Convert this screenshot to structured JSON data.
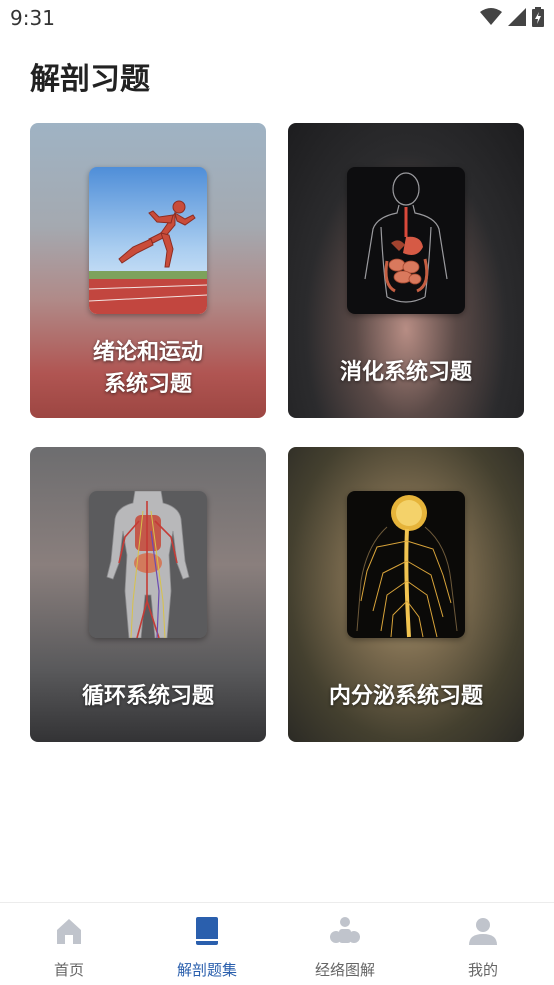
{
  "status_bar": {
    "time": "9:31"
  },
  "page": {
    "title": "解剖习题"
  },
  "cards": [
    {
      "label_line1": "绪论和运动",
      "label_line2": "系统习题",
      "image": "running-muscle-figure"
    },
    {
      "label": "消化系统习题",
      "image": "digestive-system-figure"
    },
    {
      "label": "循环系统习题",
      "image": "circulatory-system-figure"
    },
    {
      "label": "内分泌系统习题",
      "image": "nervous-endocrine-figure"
    }
  ],
  "tab_bar": {
    "active_color": "#2a5fad",
    "inactive_color": "#c0c4cc",
    "items": [
      {
        "label": "首页",
        "icon": "home-icon"
      },
      {
        "label": "解剖题集",
        "icon": "book-icon",
        "active": true
      },
      {
        "label": "经络图解",
        "icon": "meridian-icon"
      },
      {
        "label": "我的",
        "icon": "person-icon"
      }
    ]
  }
}
